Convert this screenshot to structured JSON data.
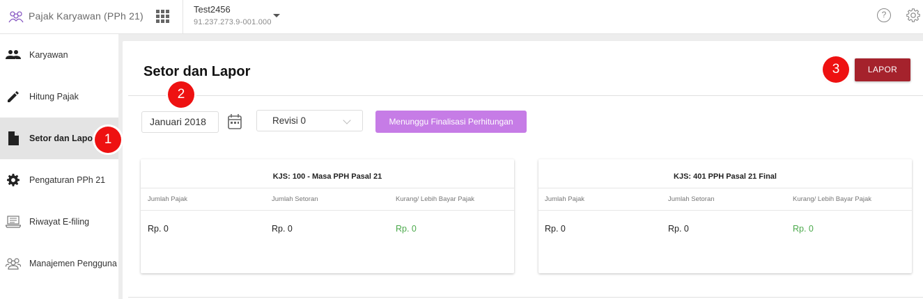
{
  "header": {
    "app_title": "Pajak Karyawan (PPh 21)",
    "company_name": "Test2456",
    "company_npwp": "91.237.273.9-001.000",
    "help_glyph": "?"
  },
  "sidebar": {
    "items": [
      {
        "label": "Karyawan",
        "icon": "people-icon",
        "active": false
      },
      {
        "label": "Hitung Pajak",
        "icon": "pencil-icon",
        "active": false
      },
      {
        "label": "Setor dan Lapor",
        "icon": "document-icon",
        "active": true
      },
      {
        "label": "Pengaturan PPh 21",
        "icon": "gear-icon",
        "active": false
      },
      {
        "label": "Riwayat E-filing",
        "icon": "laptop-icon",
        "active": false
      },
      {
        "label": "Manajemen Pengguna",
        "icon": "users-icon",
        "active": false
      }
    ]
  },
  "badges": [
    "1",
    "2",
    "3"
  ],
  "main": {
    "title": "Setor dan Lapor",
    "lapor_label": "LAPOR",
    "period": "Januari 2018",
    "revision": "Revisi 0",
    "status_label": "Menunggu Finalisasi Perhitungan"
  },
  "panels": [
    {
      "title": "KJS: 100 - Masa PPH Pasal 21",
      "columns": [
        "Jumlah Pajak",
        "Jumlah Setoran",
        "Kurang/ Lebih Bayar Pajak"
      ],
      "values": [
        "Rp. 0",
        "Rp. 0",
        "Rp. 0"
      ]
    },
    {
      "title": "KJS: 401 PPH Pasal 21 Final",
      "columns": [
        "Jumlah Pajak",
        "Jumlah Setoran",
        "Kurang/ Lebih Bayar Pajak"
      ],
      "values": [
        "Rp. 0",
        "Rp. 0",
        "Rp. 0"
      ]
    }
  ],
  "colors": {
    "lapor_button": "#a5222c",
    "status_button": "#c67ce6",
    "badge": "#ee1111",
    "positive_value": "#4aa94a"
  }
}
